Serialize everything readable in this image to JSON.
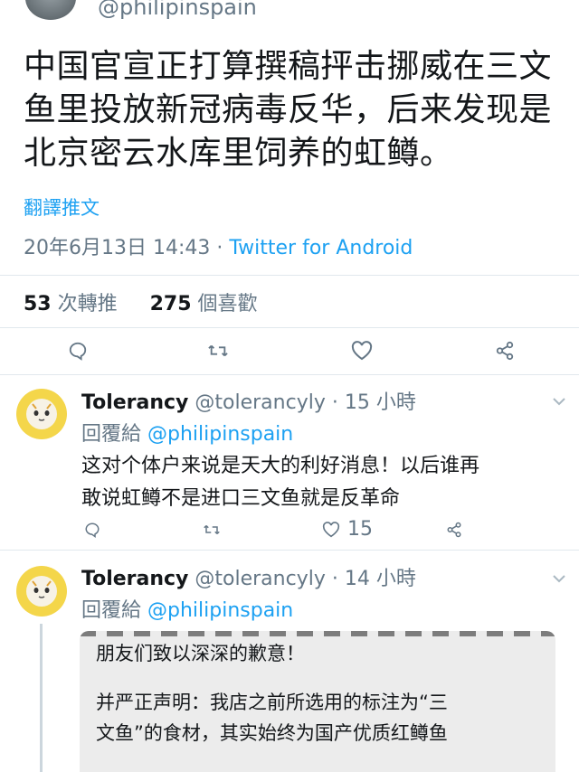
{
  "tweet": {
    "partial_handle": "@philipinspain",
    "text": "中国官宣正打算撰稿抨击挪威在三文鱼里投放新冠病毒反华，后来发现是北京密云水库里饲养的虹鳟。",
    "translate_label": "翻譯推文",
    "date": "20年6月13日 14:43 · ",
    "source": "Twitter for Android",
    "retweets_count": "53",
    "retweets_label": " 次轉推",
    "likes_count": "275",
    "likes_label": " 個喜歡"
  },
  "replies": [
    {
      "name": "Tolerancy",
      "handle": " @tolerancyly · 15 小時",
      "reply_to_label": "回覆給 ",
      "reply_to_user": "@philipinspain",
      "line1": "这对个体户来说是天大的利好消息！以后谁再",
      "line2": "敢说虹鳟不是进口三文鱼就是反革命",
      "like_count": "15"
    },
    {
      "name": "Tolerancy",
      "handle": " @tolerancyly · 14 小時",
      "reply_to_label": "回覆給 ",
      "reply_to_user": "@philipinspain",
      "quote_line1": "朋友们致以深深的歉意！",
      "quote_line2": "并严正声明：我店之前所选用的标注为“三",
      "quote_line3": "文鱼”的食材，其实始终为国产优质红鳟鱼"
    }
  ],
  "icons": [
    "reply-icon",
    "retweet-icon",
    "like-icon",
    "share-icon",
    "chevron-down-icon"
  ],
  "colors": {
    "link": "#1da1f2",
    "muted": "#657786",
    "text": "#14171a",
    "divider": "#e1e8ed"
  }
}
